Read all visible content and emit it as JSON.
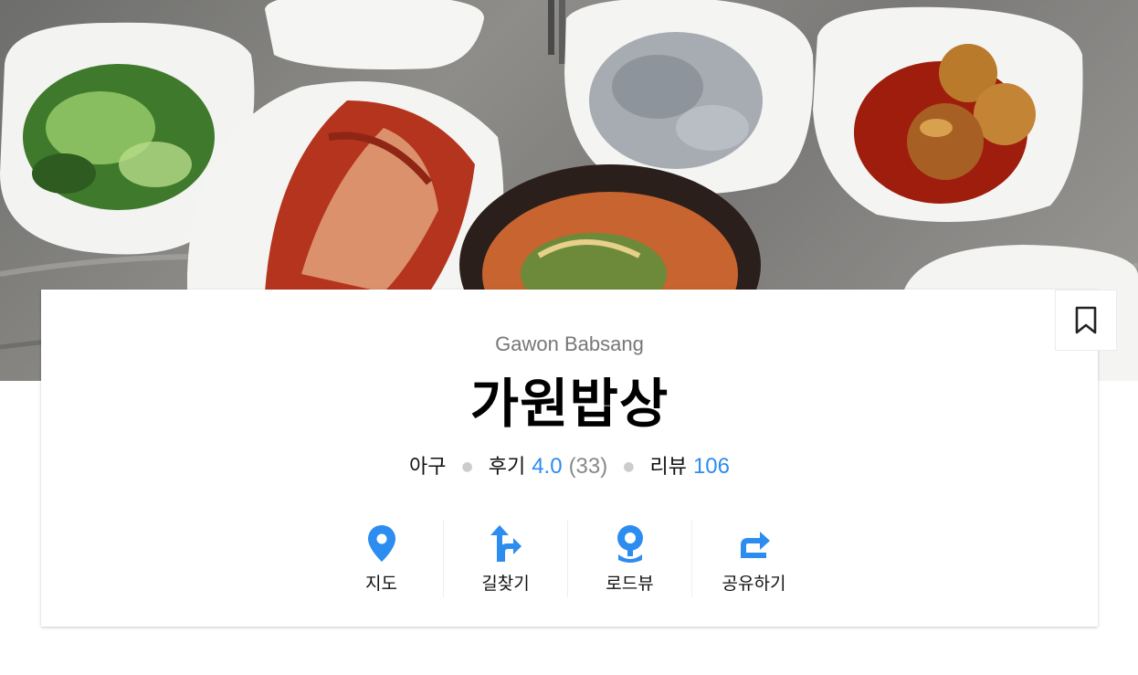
{
  "place": {
    "name_en": "Gawon Babsang",
    "name_ko": "가원밥상",
    "category": "아구",
    "review_label": "후기",
    "rating": "4.0",
    "review_count": "(33)",
    "blog_label": "리뷰",
    "blog_count": "106"
  },
  "actions": [
    {
      "label": "지도",
      "icon": "map-pin-icon"
    },
    {
      "label": "길찾기",
      "icon": "directions-icon"
    },
    {
      "label": "로드뷰",
      "icon": "roadview-icon"
    },
    {
      "label": "공유하기",
      "icon": "share-icon"
    }
  ],
  "colors": {
    "accent": "#2d8cf0",
    "muted": "#777777",
    "text": "#111111"
  }
}
